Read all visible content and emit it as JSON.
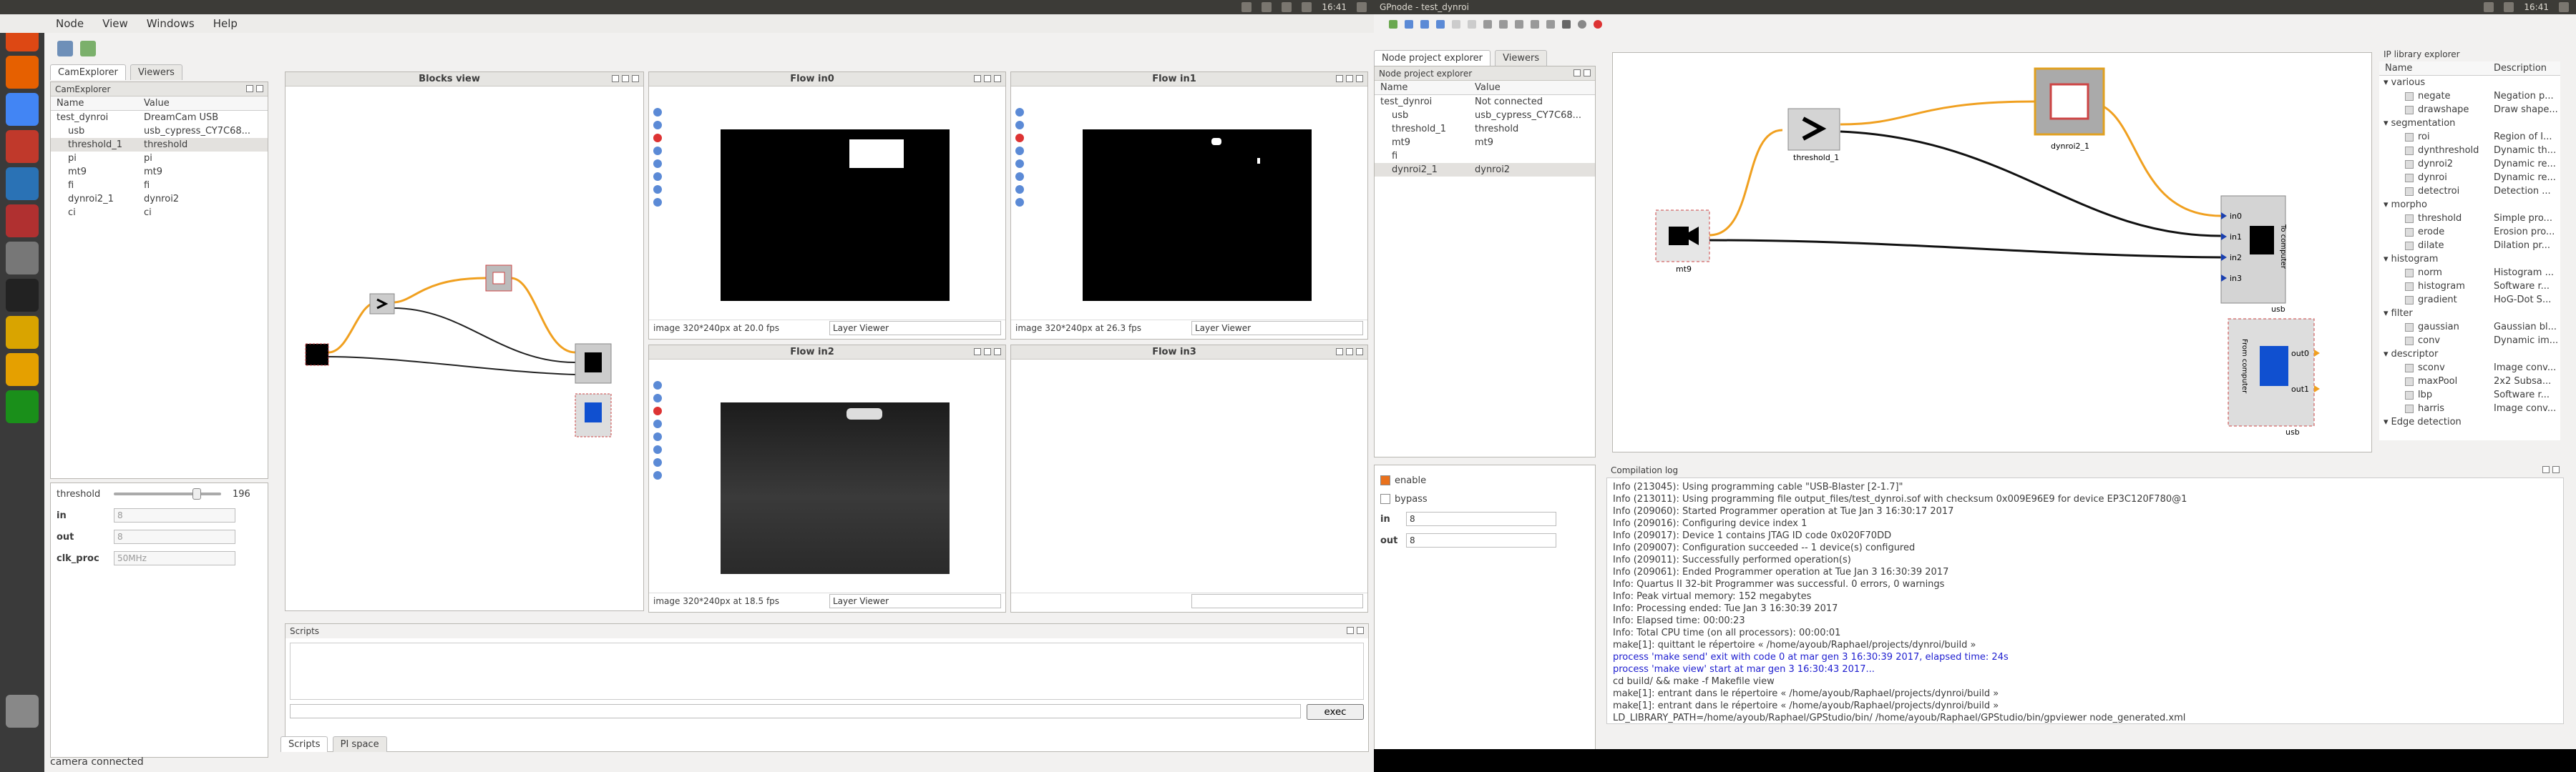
{
  "left_window": {
    "top_clock": "16:41",
    "menu": [
      "Node",
      "View",
      "Windows",
      "Help"
    ],
    "cam_explorer": {
      "tabs": [
        "CamExplorer",
        "Viewers"
      ],
      "title": "CamExplorer",
      "col_name": "Name",
      "col_value": "Value",
      "rows": [
        {
          "name": "test_dynroi",
          "value": "DreamCam USB",
          "indent": 0
        },
        {
          "name": "usb",
          "value": "usb_cypress_CY7C68...",
          "indent": 1
        },
        {
          "name": "threshold_1",
          "value": "threshold",
          "indent": 1
        },
        {
          "name": "pi",
          "value": "pi",
          "indent": 1
        },
        {
          "name": "mt9",
          "value": "mt9",
          "indent": 1
        },
        {
          "name": "fi",
          "value": "fi",
          "indent": 1
        },
        {
          "name": "dynroi2_1",
          "value": "dynroi2",
          "indent": 1
        },
        {
          "name": "ci",
          "value": "ci",
          "indent": 1
        }
      ]
    },
    "props": {
      "threshold_label": "threshold",
      "threshold_value": "196",
      "threshold_fraction": 0.77,
      "in_label": "in",
      "in_value": "8",
      "out_label": "out",
      "out_value": "8",
      "clk_label": "clk_proc",
      "clk_value": "50MHz"
    },
    "blocks_view_title": "Blocks view",
    "flows": [
      {
        "title": "Flow in0",
        "status": "image 320*240px at 20.0 fps",
        "layer": "Layer Viewer"
      },
      {
        "title": "Flow in1",
        "status": "image 320*240px at 26.3 fps",
        "layer": "Layer Viewer"
      },
      {
        "title": "Flow in2",
        "status": "image 320*240px at 18.5 fps",
        "layer": "Layer Viewer"
      },
      {
        "title": "Flow in3",
        "status": "",
        "layer": ""
      }
    ],
    "scripts": {
      "title": "Scripts",
      "exec_label": "exec",
      "tabs": [
        "Scripts",
        "PI space"
      ]
    },
    "status_bar": "camera connected"
  },
  "right_window": {
    "window_title": "GPnode - test_dynroi",
    "top_clock": "16:41",
    "node_explorer": {
      "tabs": [
        "Node project explorer",
        "Viewers"
      ],
      "title": "Node project explorer",
      "col_name": "Name",
      "col_value": "Value",
      "rows": [
        {
          "name": "test_dynroi",
          "value": "Not connected",
          "indent": 0
        },
        {
          "name": "usb",
          "value": "usb_cypress_CY7C68...",
          "indent": 1
        },
        {
          "name": "threshold_1",
          "value": "threshold",
          "indent": 1
        },
        {
          "name": "mt9",
          "value": "mt9",
          "indent": 1
        },
        {
          "name": "fi",
          "value": "",
          "indent": 1
        },
        {
          "name": "dynroi2_1",
          "value": "dynroi2",
          "indent": 1
        }
      ]
    },
    "node_props": {
      "enable_label": "enable",
      "bypass_label": "bypass",
      "in_label": "in",
      "in_value": "8",
      "out_label": "out",
      "out_value": "8"
    },
    "canvas_labels": {
      "threshold": "threshold_1",
      "dynroi": "dynroi2_1",
      "mt9": "mt9",
      "usb_in": "usb",
      "usb_out": "usb",
      "to_computer": "To computer",
      "from_computer": "From computer",
      "ports_in": [
        "in0",
        "in1",
        "in2",
        "in3"
      ],
      "ports_out": [
        "out0",
        "out1"
      ]
    },
    "ip_library": {
      "title": "IP library explorer",
      "col_name": "Name",
      "col_desc": "Description",
      "groups": [
        {
          "name": "various",
          "items": [
            {
              "n": "negate",
              "d": "Negation p..."
            },
            {
              "n": "drawshape",
              "d": "Draw shape..."
            }
          ]
        },
        {
          "name": "segmentation",
          "items": [
            {
              "n": "roi",
              "d": "Region of I..."
            },
            {
              "n": "dynthreshold",
              "d": "Dynamic th..."
            },
            {
              "n": "dynroi2",
              "d": "Dynamic re..."
            },
            {
              "n": "dynroi",
              "d": "Dynamic re..."
            },
            {
              "n": "detectroi",
              "d": "Detection ..."
            }
          ]
        },
        {
          "name": "morpho",
          "items": [
            {
              "n": "threshold",
              "d": "Simple pro..."
            },
            {
              "n": "erode",
              "d": "Erosion pro..."
            },
            {
              "n": "dilate",
              "d": "Dilation pr..."
            }
          ]
        },
        {
          "name": "histogram",
          "items": [
            {
              "n": "norm",
              "d": "Histogram ..."
            },
            {
              "n": "histogram",
              "d": "Software r..."
            },
            {
              "n": "gradient",
              "d": "HoG-Dot S..."
            }
          ]
        },
        {
          "name": "filter",
          "items": [
            {
              "n": "gaussian",
              "d": "Gaussian bl..."
            },
            {
              "n": "conv",
              "d": "Dynamic im..."
            }
          ]
        },
        {
          "name": "descriptor",
          "items": [
            {
              "n": "sconv",
              "d": "Image conv..."
            },
            {
              "n": "maxPool",
              "d": "2x2 Subsa..."
            },
            {
              "n": "lbp",
              "d": "Software r..."
            },
            {
              "n": "harris",
              "d": "Image conv..."
            }
          ]
        },
        {
          "name": "Edge detection",
          "items": []
        }
      ]
    },
    "compilation_log": {
      "title": "Compilation log",
      "lines": [
        {
          "t": "Info (213045): Using programming cable \"USB-Blaster [2-1.7]\"",
          "c": ""
        },
        {
          "t": "Info (213011): Using programming file output_files/test_dynroi.sof with checksum 0x009E96E9 for device EP3C120F780@1",
          "c": ""
        },
        {
          "t": "Info (209060): Started Programmer operation at Tue Jan 3 16:30:17 2017",
          "c": ""
        },
        {
          "t": "Info (209016): Configuring device index 1",
          "c": ""
        },
        {
          "t": "Info (209017): Device 1 contains JTAG ID code 0x020F70DD",
          "c": ""
        },
        {
          "t": "Info (209007): Configuration succeeded -- 1 device(s) configured",
          "c": ""
        },
        {
          "t": "Info (209011): Successfully performed operation(s)",
          "c": ""
        },
        {
          "t": "Info (209061): Ended Programmer operation at Tue Jan 3 16:30:39 2017",
          "c": ""
        },
        {
          "t": "Info: Quartus II 32-bit Programmer was successful. 0 errors, 0 warnings",
          "c": ""
        },
        {
          "t": "Info: Peak virtual memory: 152 megabytes",
          "c": ""
        },
        {
          "t": "Info: Processing ended: Tue Jan 3 16:30:39 2017",
          "c": ""
        },
        {
          "t": "Info: Elapsed time: 00:00:23",
          "c": ""
        },
        {
          "t": "Info: Total CPU time (on all processors): 00:00:01",
          "c": ""
        },
        {
          "t": "make[1]: quittant le répertoire « /home/ayoub/Raphael/projects/dynroi/build »",
          "c": ""
        },
        {
          "t": "process 'make send' exit with code 0 at mar gen 3 16:30:39 2017, elapsed time: 24s",
          "c": "blue"
        },
        {
          "t": "process 'make view' start at mar gen 3 16:30:43 2017...",
          "c": "blue"
        },
        {
          "t": "cd build/ && make -f Makefile view",
          "c": ""
        },
        {
          "t": "make[1]: entrant dans le répertoire « /home/ayoub/Raphael/projects/dynroi/build »",
          "c": ""
        },
        {
          "t": "make[1]: entrant dans le répertoire « /home/ayoub/Raphael/projects/dynroi/build »",
          "c": ""
        },
        {
          "t": "LD_LIBRARY_PATH=/home/ayoub/Raphael/GPStudio/bin/ /home/ayoub/Raphael/GPStudio/bin/gpviewer node_generated.xml",
          "c": ""
        }
      ]
    }
  }
}
